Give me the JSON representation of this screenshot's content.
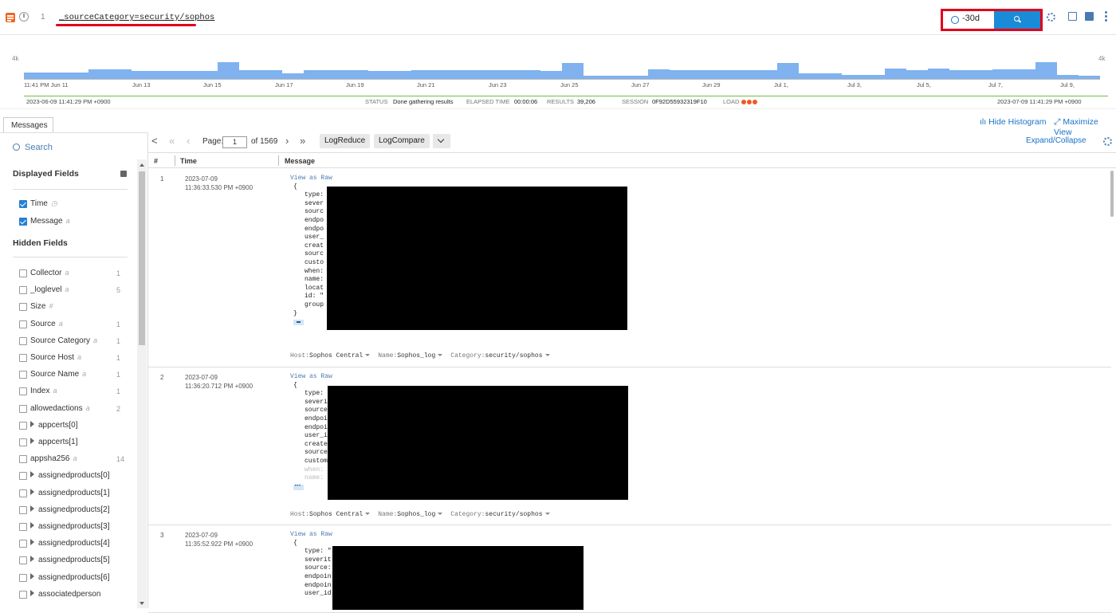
{
  "query": {
    "line_number": "1",
    "text": "_sourceCategory=security/sophos"
  },
  "time_range": {
    "value": "-30d"
  },
  "histogram": {
    "y_max_label": "4k",
    "x_labels": [
      "11:41 PM Jun 11",
      "Jun 13",
      "Jun 15",
      "Jun 17",
      "Jun 19",
      "Jun 21",
      "Jun 23",
      "Jun 25",
      "Jun 27",
      "Jun 29",
      "Jul 1,",
      "Jul 3,",
      "Jul 5,",
      "Jul 7,",
      "Jul 9,"
    ],
    "bar_levels": [
      0.35,
      0.35,
      0.35,
      0.55,
      0.55,
      0.45,
      0.45,
      0.45,
      0.45,
      0.95,
      0.5,
      0.5,
      0.3,
      0.5,
      0.5,
      0.5,
      0.45,
      0.45,
      0.5,
      0.5,
      0.5,
      0.5,
      0.5,
      0.5,
      0.45,
      0.9,
      0.2,
      0.2,
      0.2,
      0.55,
      0.5,
      0.5,
      0.5,
      0.5,
      0.5,
      0.9,
      0.3,
      0.3,
      0.25,
      0.25,
      0.6,
      0.5,
      0.6,
      0.5,
      0.5,
      0.55,
      0.55,
      0.95,
      0.25,
      0.2
    ]
  },
  "status": {
    "start_time": "2023-06-09 11:41:29 PM +0900",
    "end_time": "2023-07-09 11:41:29 PM +0900",
    "status_label": "STATUS",
    "status_value": "Done gathering results",
    "elapsed_label": "ELAPSED TIME",
    "elapsed_value": "00:00:06",
    "results_label": "RESULTS",
    "results_value": "39,206",
    "session_label": "SESSION",
    "session_value": "0F92D55932319F10",
    "load_label": "LOAD"
  },
  "tabs": {
    "messages": "Messages",
    "hide_histogram": "Hide Histogram",
    "maximize_view": "Maximize View"
  },
  "sidebar": {
    "search_placeholder": "Search",
    "displayed_title": "Displayed Fields",
    "hidden_title": "Hidden Fields",
    "displayed": [
      {
        "name": "Time",
        "type": "◷"
      },
      {
        "name": "Message",
        "type": "a"
      }
    ],
    "hidden": [
      {
        "name": "Collector",
        "type": "a",
        "count": "1",
        "expand": false
      },
      {
        "name": "_loglevel",
        "type": "a",
        "count": "5",
        "expand": false
      },
      {
        "name": "Size",
        "type": "#",
        "count": "",
        "expand": false
      },
      {
        "name": "Source",
        "type": "a",
        "count": "1",
        "expand": false
      },
      {
        "name": "Source Category",
        "type": "a",
        "count": "1",
        "expand": false
      },
      {
        "name": "Source Host",
        "type": "a",
        "count": "1",
        "expand": false
      },
      {
        "name": "Source Name",
        "type": "a",
        "count": "1",
        "expand": false
      },
      {
        "name": "Index",
        "type": "a",
        "count": "1",
        "expand": false
      },
      {
        "name": "allowedactions",
        "type": "a",
        "count": "2",
        "expand": false
      },
      {
        "name": "appcerts[0]",
        "type": "",
        "count": "",
        "expand": true
      },
      {
        "name": "appcerts[1]",
        "type": "",
        "count": "",
        "expand": true
      },
      {
        "name": "appsha256",
        "type": "a",
        "count": "14",
        "expand": false
      },
      {
        "name": "assignedproducts[0]",
        "type": "",
        "count": "",
        "expand": true
      },
      {
        "name": "assignedproducts[1]",
        "type": "",
        "count": "",
        "expand": true
      },
      {
        "name": "assignedproducts[2]",
        "type": "",
        "count": "",
        "expand": true
      },
      {
        "name": "assignedproducts[3]",
        "type": "",
        "count": "",
        "expand": true
      },
      {
        "name": "assignedproducts[4]",
        "type": "",
        "count": "",
        "expand": true
      },
      {
        "name": "assignedproducts[5]",
        "type": "",
        "count": "",
        "expand": true
      },
      {
        "name": "assignedproducts[6]",
        "type": "",
        "count": "",
        "expand": true
      },
      {
        "name": "associatedperson",
        "type": "",
        "count": "",
        "expand": true
      }
    ]
  },
  "toolbar": {
    "page_label": "Page:",
    "page_value": "1",
    "of_label": "of 1569",
    "logreduce": "LogReduce",
    "logcompare": "LogCompare",
    "expand_collapse": "Expand/Collapse"
  },
  "table": {
    "col_num": "#",
    "col_time": "Time",
    "col_message": "Message",
    "view_as_raw": "View as Raw",
    "rows": [
      {
        "num": "1",
        "date": "2023-07-09",
        "time": "11:36:33.530 PM +0900",
        "keys": [
          "type:",
          "sever",
          "sourc",
          "endpo",
          "endpo",
          "user_",
          "creat",
          "sourc",
          "custo",
          "when:",
          "name:",
          "locat",
          "id: \"",
          "group"
        ],
        "host": "Sophos Central",
        "name": "Sophos_log",
        "category": "security/sophos"
      },
      {
        "num": "2",
        "date": "2023-07-09",
        "time": "11:36:20.712 PM +0900",
        "keys": [
          "type:",
          "severi",
          "source",
          "endpoi",
          "endpoi",
          "user_i",
          "create",
          "source",
          "custom",
          "when:",
          "name:"
        ],
        "host": "Sophos Central",
        "name": "Sophos_log",
        "category": "security/sophos"
      },
      {
        "num": "3",
        "date": "2023-07-09",
        "time": "11:35:52.922 PM +0900",
        "keys": [
          "type: \"",
          "severit",
          "source:",
          "endpoin",
          "endpoin",
          "user_id"
        ],
        "host": "",
        "name": "",
        "category": ""
      }
    ],
    "meta_host": "Host:",
    "meta_name": "Name:",
    "meta_category": "Category:"
  }
}
